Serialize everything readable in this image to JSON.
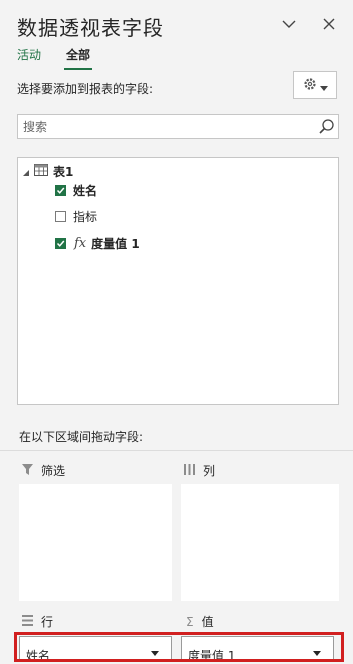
{
  "panel": {
    "title": "数据透视表字段",
    "tabs": [
      {
        "label": "活动",
        "active": false
      },
      {
        "label": "全部",
        "active": true
      }
    ],
    "instruction": "选择要添加到报表的字段:",
    "accent_color": "#217346"
  },
  "search": {
    "placeholder": "搜索",
    "icon": "search-icon"
  },
  "fields": {
    "table_name": "表1",
    "items": [
      {
        "label": "姓名",
        "checked": true,
        "bold": true
      },
      {
        "label": "指标",
        "checked": false,
        "bold": false
      },
      {
        "label": "度量值 1",
        "checked": true,
        "bold": true,
        "measure": true,
        "measure_icon": "fx"
      }
    ]
  },
  "areas": {
    "instruction": "在以下区域间拖动字段:",
    "filters": {
      "label": "筛选",
      "icon": "filter-icon"
    },
    "columns": {
      "label": "列",
      "icon": "columns-icon"
    },
    "rows": {
      "label": "行",
      "icon": "rows-icon",
      "items": [
        "姓名"
      ]
    },
    "values": {
      "label": "值",
      "icon": "sigma-icon",
      "symbol": "Σ",
      "items": [
        "度量值 1"
      ]
    }
  },
  "highlight_color": "#d11f1f"
}
